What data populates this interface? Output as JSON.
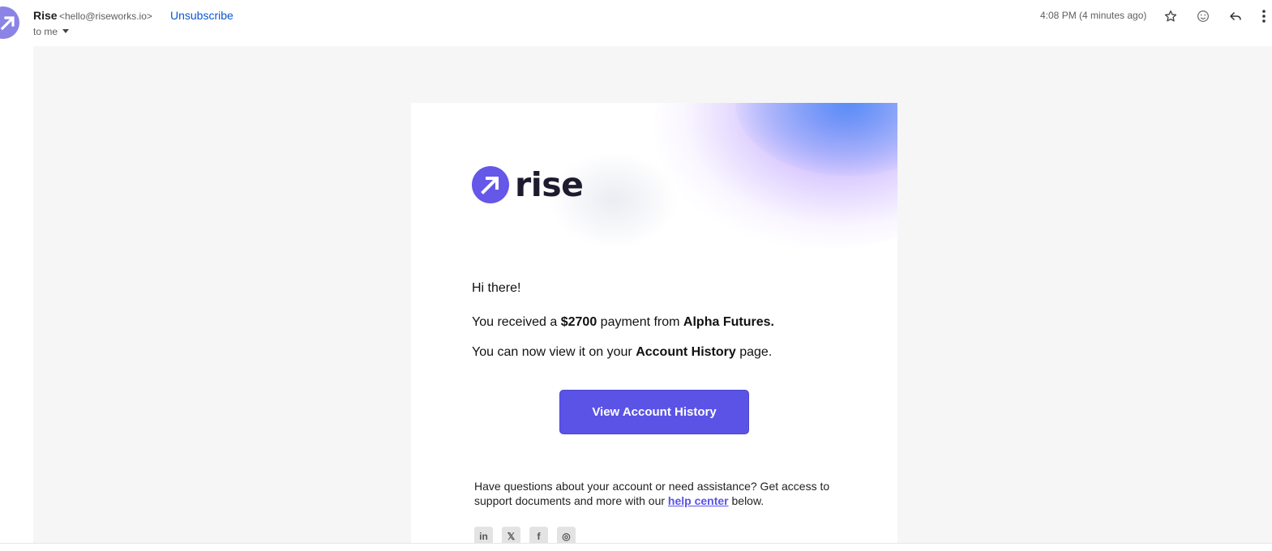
{
  "header": {
    "sender_name": "Rise",
    "sender_email": "<hello@riseworks.io>",
    "unsubscribe_label": "Unsubscribe",
    "recipient_label": "to me",
    "timestamp": "4:08 PM (4 minutes ago)",
    "icons": [
      "star-icon",
      "emoji-icon",
      "reply-icon",
      "more-vert-icon"
    ]
  },
  "email": {
    "logo_text": "rise",
    "greeting": "Hi there!",
    "line1": {
      "prefix": "You received a ",
      "amount": "$2700",
      "middle": " payment from ",
      "company": "Alpha Futures."
    },
    "line2": {
      "prefix": "You can now view it on your ",
      "page_name": "Account History",
      "suffix": " page."
    },
    "cta_label": "View Account History",
    "help": {
      "prefix": "Have questions about your account or need assistance? Get access to support documents and more with our ",
      "link_text": "help center",
      "suffix": " below."
    },
    "social": [
      {
        "icon": "linkedin-icon",
        "glyph": "in"
      },
      {
        "icon": "x-icon",
        "glyph": "𝕏"
      },
      {
        "icon": "facebook-icon",
        "glyph": "f"
      },
      {
        "icon": "instagram-icon",
        "glyph": "◎"
      }
    ]
  },
  "colors": {
    "brand": "#5a53e6",
    "link": "#0b57d0",
    "canvas": "#f6f6f6"
  }
}
